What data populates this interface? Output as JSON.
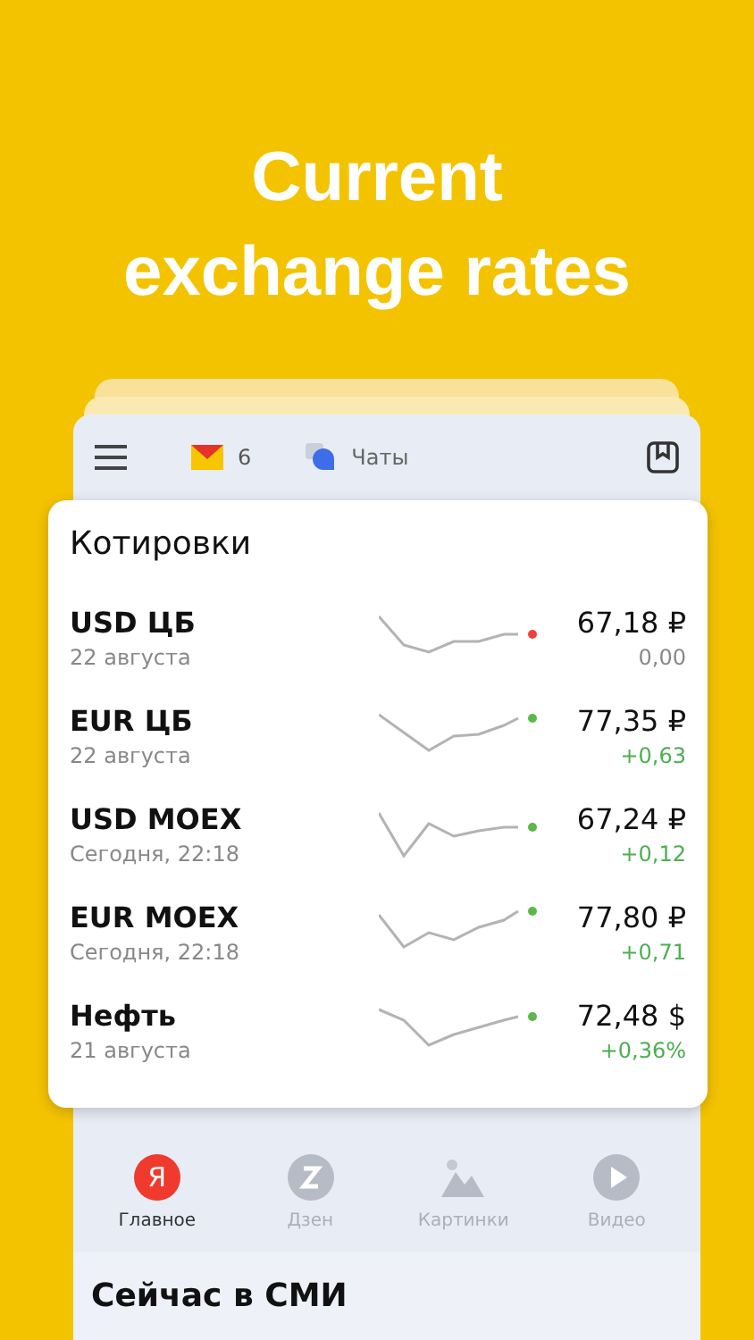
{
  "headline": "Current exchange rates",
  "toolbar": {
    "mail_count": "6",
    "chats_label": "Чаты"
  },
  "quotes": {
    "title": "Котировки",
    "rows": [
      {
        "name": "USD ЦБ",
        "date": "22 августа",
        "value": "67,18 ₽",
        "change": "0,00",
        "kind": "flat",
        "color": "#f0403a"
      },
      {
        "name": "EUR ЦБ",
        "date": "22 августа",
        "value": "77,35 ₽",
        "change": "+0,63",
        "kind": "up",
        "color": "#5cb84a"
      },
      {
        "name": "USD MOEX",
        "date": "Сегодня, 22:18",
        "value": "67,24 ₽",
        "change": "+0,12",
        "kind": "up",
        "color": "#5cb84a"
      },
      {
        "name": "EUR MOEX",
        "date": "Сегодня, 22:18",
        "value": "77,80 ₽",
        "change": "+0,71",
        "kind": "up",
        "color": "#5cb84a"
      },
      {
        "name": "Нефть",
        "date": "21 августа",
        "value": "72,48 $",
        "change": "+0,36%",
        "kind": "up",
        "color": "#5cb84a"
      }
    ]
  },
  "nav": [
    {
      "kind": "logo",
      "letter": "Я",
      "label": "Главное",
      "selected": true
    },
    {
      "kind": "zen",
      "label": "Дзен",
      "selected": false
    },
    {
      "kind": "images",
      "label": "Картинки",
      "selected": false
    },
    {
      "kind": "video",
      "label": "Видео",
      "selected": false
    }
  ],
  "section_title": "Сейчас в СМИ"
}
